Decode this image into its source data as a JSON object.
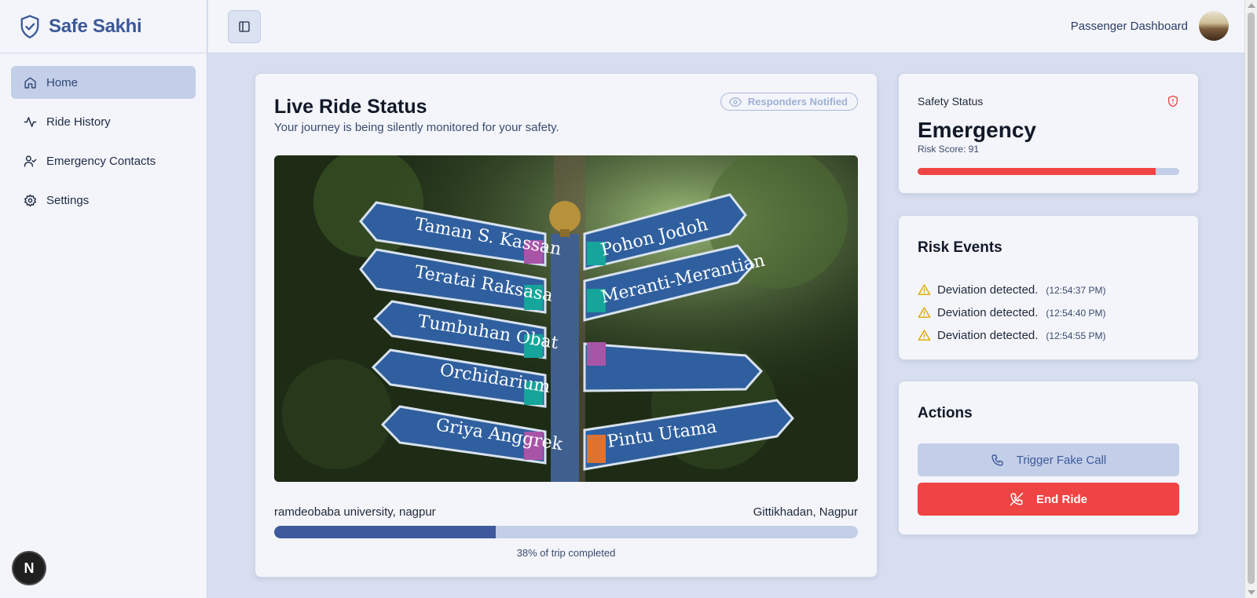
{
  "brand": {
    "name": "Safe Sakhi",
    "icon": "shield-check-icon",
    "color": "#3b5998"
  },
  "sidebar": {
    "items": [
      {
        "label": "Home",
        "icon": "home-icon",
        "active": true
      },
      {
        "label": "Ride History",
        "icon": "activity-icon",
        "active": false
      },
      {
        "label": "Emergency Contacts",
        "icon": "user-check-icon",
        "active": false
      },
      {
        "label": "Settings",
        "icon": "gear-icon",
        "active": false
      }
    ],
    "dev_badge": "N"
  },
  "header": {
    "title": "Passenger Dashboard"
  },
  "ride": {
    "title": "Live Ride Status",
    "subtitle": "Your journey is being silently monitored for your safety.",
    "badge": "Responders Notified",
    "from": "ramdeobaba university, nagpur",
    "to": "Gittikhadan, Nagpur",
    "progress_percent": 38,
    "progress_text": "38% of trip completed",
    "image_signs": [
      "Taman S. Kassan",
      "Teratai Raksasa",
      "Tumbuhan Obat",
      "Orchidarium",
      "Griya Anggrek",
      "Pohon Jodoh",
      "Meranti-Merantian",
      "Pintu Utama"
    ]
  },
  "safety": {
    "label": "Safety Status",
    "status": "Emergency",
    "score_text": "Risk Score: 91",
    "score": 91,
    "accent": "#ef4444"
  },
  "risk_events": {
    "title": "Risk Events",
    "items": [
      {
        "text": "Deviation detected.",
        "time": "(12:54:37 PM)"
      },
      {
        "text": "Deviation detected.",
        "time": "(12:54:40 PM)"
      },
      {
        "text": "Deviation detected.",
        "time": "(12:54:55 PM)"
      }
    ]
  },
  "actions": {
    "title": "Actions",
    "fake_call": "Trigger Fake Call",
    "end_ride": "End Ride"
  }
}
